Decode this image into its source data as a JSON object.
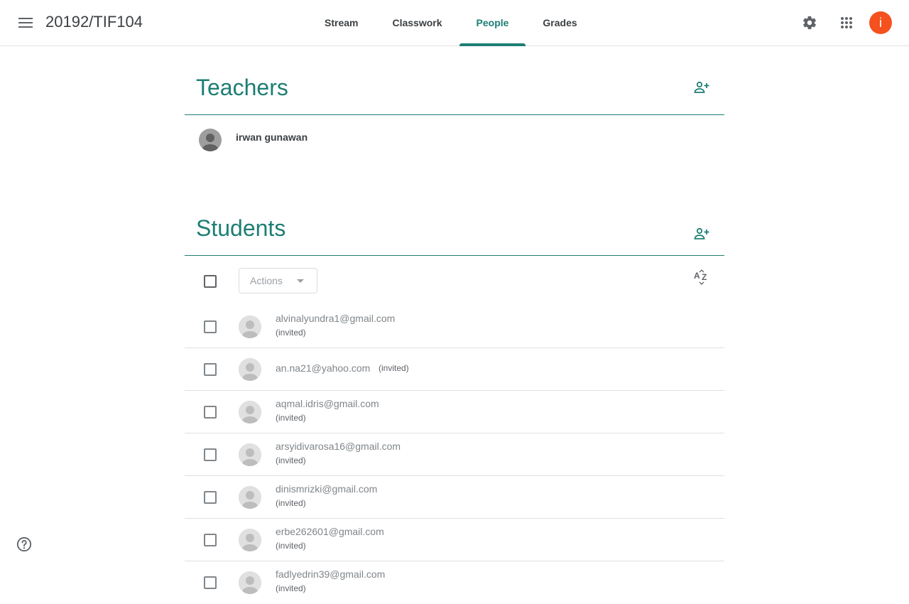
{
  "header": {
    "class_name": "20192/TIF104",
    "tabs": [
      {
        "label": "Stream"
      },
      {
        "label": "Classwork"
      },
      {
        "label": "People"
      },
      {
        "label": "Grades"
      }
    ],
    "active_tab": "People",
    "account_initial": "i",
    "accent_color": "#1e7e74",
    "avatar_color": "#f4511e"
  },
  "teachers": {
    "title": "Teachers",
    "items": [
      {
        "name": "irwan gunawan"
      }
    ]
  },
  "students": {
    "title": "Students",
    "actions_label": "Actions",
    "items": [
      {
        "email": "alvinalyundra1@gmail.com",
        "status": "(invited)"
      },
      {
        "email": "an.na21@yahoo.com",
        "status": "(invited)"
      },
      {
        "email": "aqmal.idris@gmail.com",
        "status": "(invited)"
      },
      {
        "email": "arsyidivarosa16@gmail.com",
        "status": "(invited)"
      },
      {
        "email": "dinismrizki@gmail.com",
        "status": "(invited)"
      },
      {
        "email": "erbe262601@gmail.com",
        "status": "(invited)"
      },
      {
        "email": "fadlyedrin39@gmail.com",
        "status": "(invited)"
      }
    ]
  },
  "icons": {
    "menu": "menu-icon",
    "settings": "gear-icon",
    "apps": "apps-grid-icon",
    "invite": "person-add-icon",
    "sort": "sort-az-icon",
    "help": "help-icon"
  }
}
